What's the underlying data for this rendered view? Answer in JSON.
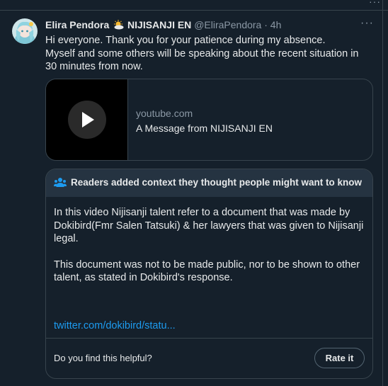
{
  "tweet": {
    "author": {
      "name": "Elira Pendora",
      "affiliation": "NIJISANJI EN",
      "handle": "@EliraPendora",
      "separator": "·",
      "time": "4h"
    },
    "more_icon": "more-horizontal-icon",
    "text_lines": [
      "Hi everyone. Thank you for your patience during my absence.",
      "Myself and some others will be speaking about the recent situation in 30 minutes from now."
    ],
    "link_card": {
      "domain": "youtube.com",
      "title": "A Message from NIJISANJI EN",
      "icon": "play-icon"
    },
    "community_note": {
      "icon": "people-icon",
      "heading": "Readers added context they thought people might want to know",
      "paragraphs": [
        "In this video Nijisanji talent refer to a document that was made by Dokibird(Fmr Salen Tatsuki) & her lawyers that was given to Nijisanji legal.",
        "This document was not to be made public, nor to be shown to other talent, as stated in Dokibird's response."
      ],
      "link_text": "twitter.com/dokibird/statu...",
      "helpful_prompt": "Do you find this helpful?",
      "rate_button": "Rate it"
    }
  },
  "colors": {
    "background": "#15202b",
    "text": "#e7e9ea",
    "muted": "#8b98a5",
    "border": "#38444d",
    "link": "#1d9bf0",
    "note_header": "#253341"
  }
}
